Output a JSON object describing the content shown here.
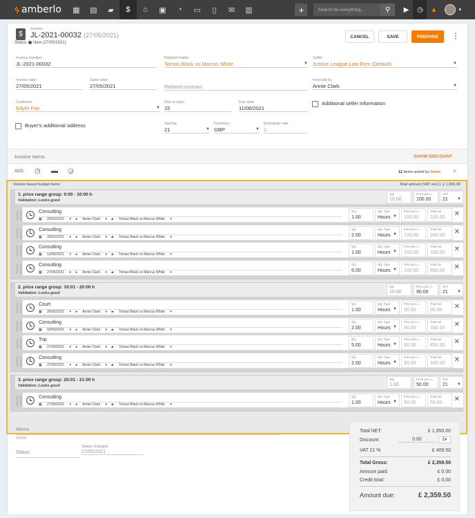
{
  "app": {
    "name": "amberlo",
    "search_placeholder": "Search for everything..."
  },
  "invoice": {
    "type_label": "Invoice",
    "number": "JL-2021-00032",
    "date_suffix": "(27/05/2021)",
    "status_prefix": "Status:",
    "status": "New (27/05/2021)"
  },
  "actions": {
    "cancel": "CANCEL",
    "save": "SAVE",
    "prepare": "PREPARE"
  },
  "fields": {
    "invoice_number": {
      "label": "Invoice number",
      "value": "JL-2021-00032"
    },
    "related_matter": {
      "label": "Related matter",
      "value": "Tomas Black vs Marcus White"
    },
    "seller": {
      "label": "Seller",
      "value": "Justice League Law Firm (Default)"
    },
    "invoice_date": {
      "label": "Invoice date",
      "value": "27/05/2021"
    },
    "sales_date": {
      "label": "Sales date",
      "value": "27/05/2021"
    },
    "related_contract": {
      "placeholder": "Related contract"
    },
    "invoiced_by": {
      "label": "Invoiced by",
      "value": "Annie Clark"
    },
    "customer": {
      "label": "Customer",
      "value": "Edyth Fae"
    },
    "due_in_days": {
      "label": "Due in days",
      "value": "15"
    },
    "due_date": {
      "label": "Due date",
      "value": "11/06/2021"
    },
    "additional_seller_info": "Additional seller information",
    "buyers_additional_address": "Buyer's additional address",
    "tax_vat": {
      "label": "Tax/Vat",
      "value": "21"
    },
    "currency": {
      "label": "Currency",
      "value": "GBP"
    },
    "exchange_rate": {
      "label": "Exchange rate",
      "value": "1"
    }
  },
  "items_section": {
    "title": "Invoice items",
    "show_discount": "SHOW DISCOUNT",
    "add_label": "ADD:",
    "sort_count": "12",
    "sort_text": "items sorted by",
    "sort_field": "Date"
  },
  "budget": {
    "title": "Volume based budget items",
    "total_label": "Total amount (VAT excl.): £ 1,950.00"
  },
  "field_labels": {
    "qty": "Qty",
    "qty_type": "Qty. Type",
    "price_per": "Price per u...",
    "total_net": "Total net",
    "vat": "VAT"
  },
  "groups": [
    {
      "title": "1. price range group: 0:00 - 10:00 h",
      "validation": "Validation: Looks good",
      "qty": "10.00",
      "price": "100.00",
      "vat": "21",
      "items": [
        {
          "name": "Consulting",
          "date": "26/02/2021",
          "user": "Annie Clark",
          "matter": "Tomas Black vs Marcus White",
          "qty": "1.00",
          "qty_type": "Hours",
          "price": "100.00",
          "total": "100.00"
        },
        {
          "name": "Consulting",
          "date": "26/02/2021",
          "user": "Annie Clark",
          "matter": "Tomas Black vs Marcus White",
          "qty": "2.00",
          "qty_type": "Hours",
          "price": "100.00",
          "total": "200.00"
        },
        {
          "name": "Consulting",
          "date": "13/05/2021",
          "user": "Annie Clark",
          "matter": "Tomas Black vs Marcus White",
          "qty": "1.00",
          "qty_type": "Hours",
          "price": "100.00",
          "total": "100.00"
        },
        {
          "name": "Consulting",
          "date": "27/05/2021",
          "user": "Annie Clark",
          "matter": "Tomas Black vs Marcus White",
          "qty": "6.00",
          "qty_type": "Hours",
          "price": "100.00",
          "total": "600.00"
        }
      ]
    },
    {
      "title": "2. price range group: 10:01 - 20:00 h",
      "validation": "Validation: Looks good",
      "qty": "10.00",
      "price": "90.00",
      "vat": "21",
      "items": [
        {
          "name": "Court",
          "date": "26/02/2021",
          "user": "Annie Clark",
          "matter": "Tomas Black vs Marcus White",
          "qty": "1.00",
          "qty_type": "Hours",
          "price": "90.00",
          "total": "90.00"
        },
        {
          "name": "Consulting",
          "date": "03/05/2021",
          "user": "Annie Clark",
          "matter": "Tomas Black vs Marcus White",
          "qty": "2.00",
          "qty_type": "Hours",
          "price": "90.00",
          "total": "180.00"
        },
        {
          "name": "Trip",
          "date": "27/05/2021",
          "user": "Annie Clark",
          "matter": "Tomas Black vs Marcus White",
          "qty": "5.00",
          "qty_type": "Hours",
          "price": "90.00",
          "total": "450.00"
        },
        {
          "name": "Consulting",
          "date": "27/05/2021",
          "user": "Annie Clark",
          "matter": "Tomas Black vs Marcus White",
          "qty": "2.00",
          "qty_type": "Hours",
          "price": "90.00",
          "total": "180.00"
        }
      ]
    },
    {
      "title": "3. price range group: 20:01 - 21:00 h",
      "validation": "Validation: Looks good",
      "qty": "1.00",
      "price": "50.00",
      "vat": "21",
      "items": [
        {
          "name": "Consulting",
          "date": "27/05/2021",
          "user": "Annie Clark",
          "matter": "Tomas Black vs Marcus White",
          "qty": "1.00",
          "qty_type": "Hours",
          "price": "50.00",
          "total": "50.00"
        }
      ]
    }
  ],
  "memo": {
    "label": "Memo",
    "counter": "0/2000"
  },
  "status_block": {
    "label": "Status",
    "changed_label": "Status changed",
    "changed_value": "27/05/2021"
  },
  "totals": {
    "total_net": {
      "label": "Total NET:",
      "value": "£ 1,950.00"
    },
    "discount": {
      "label": "Discount",
      "value": "0.00",
      "unit": "£"
    },
    "vat": {
      "label": "VAT 21 %",
      "value": "£ 409.50"
    },
    "total_gross": {
      "label": "Total Gross:",
      "value": "£ 2,359.50"
    },
    "amount_paid": {
      "label": "Amount paid:",
      "value": "£ 0.00"
    },
    "credit_total": {
      "label": "Credit total:",
      "value": "£ 0.00"
    },
    "amount_due": {
      "label": "Amount due:",
      "value": "£ 2,359.50"
    }
  }
}
